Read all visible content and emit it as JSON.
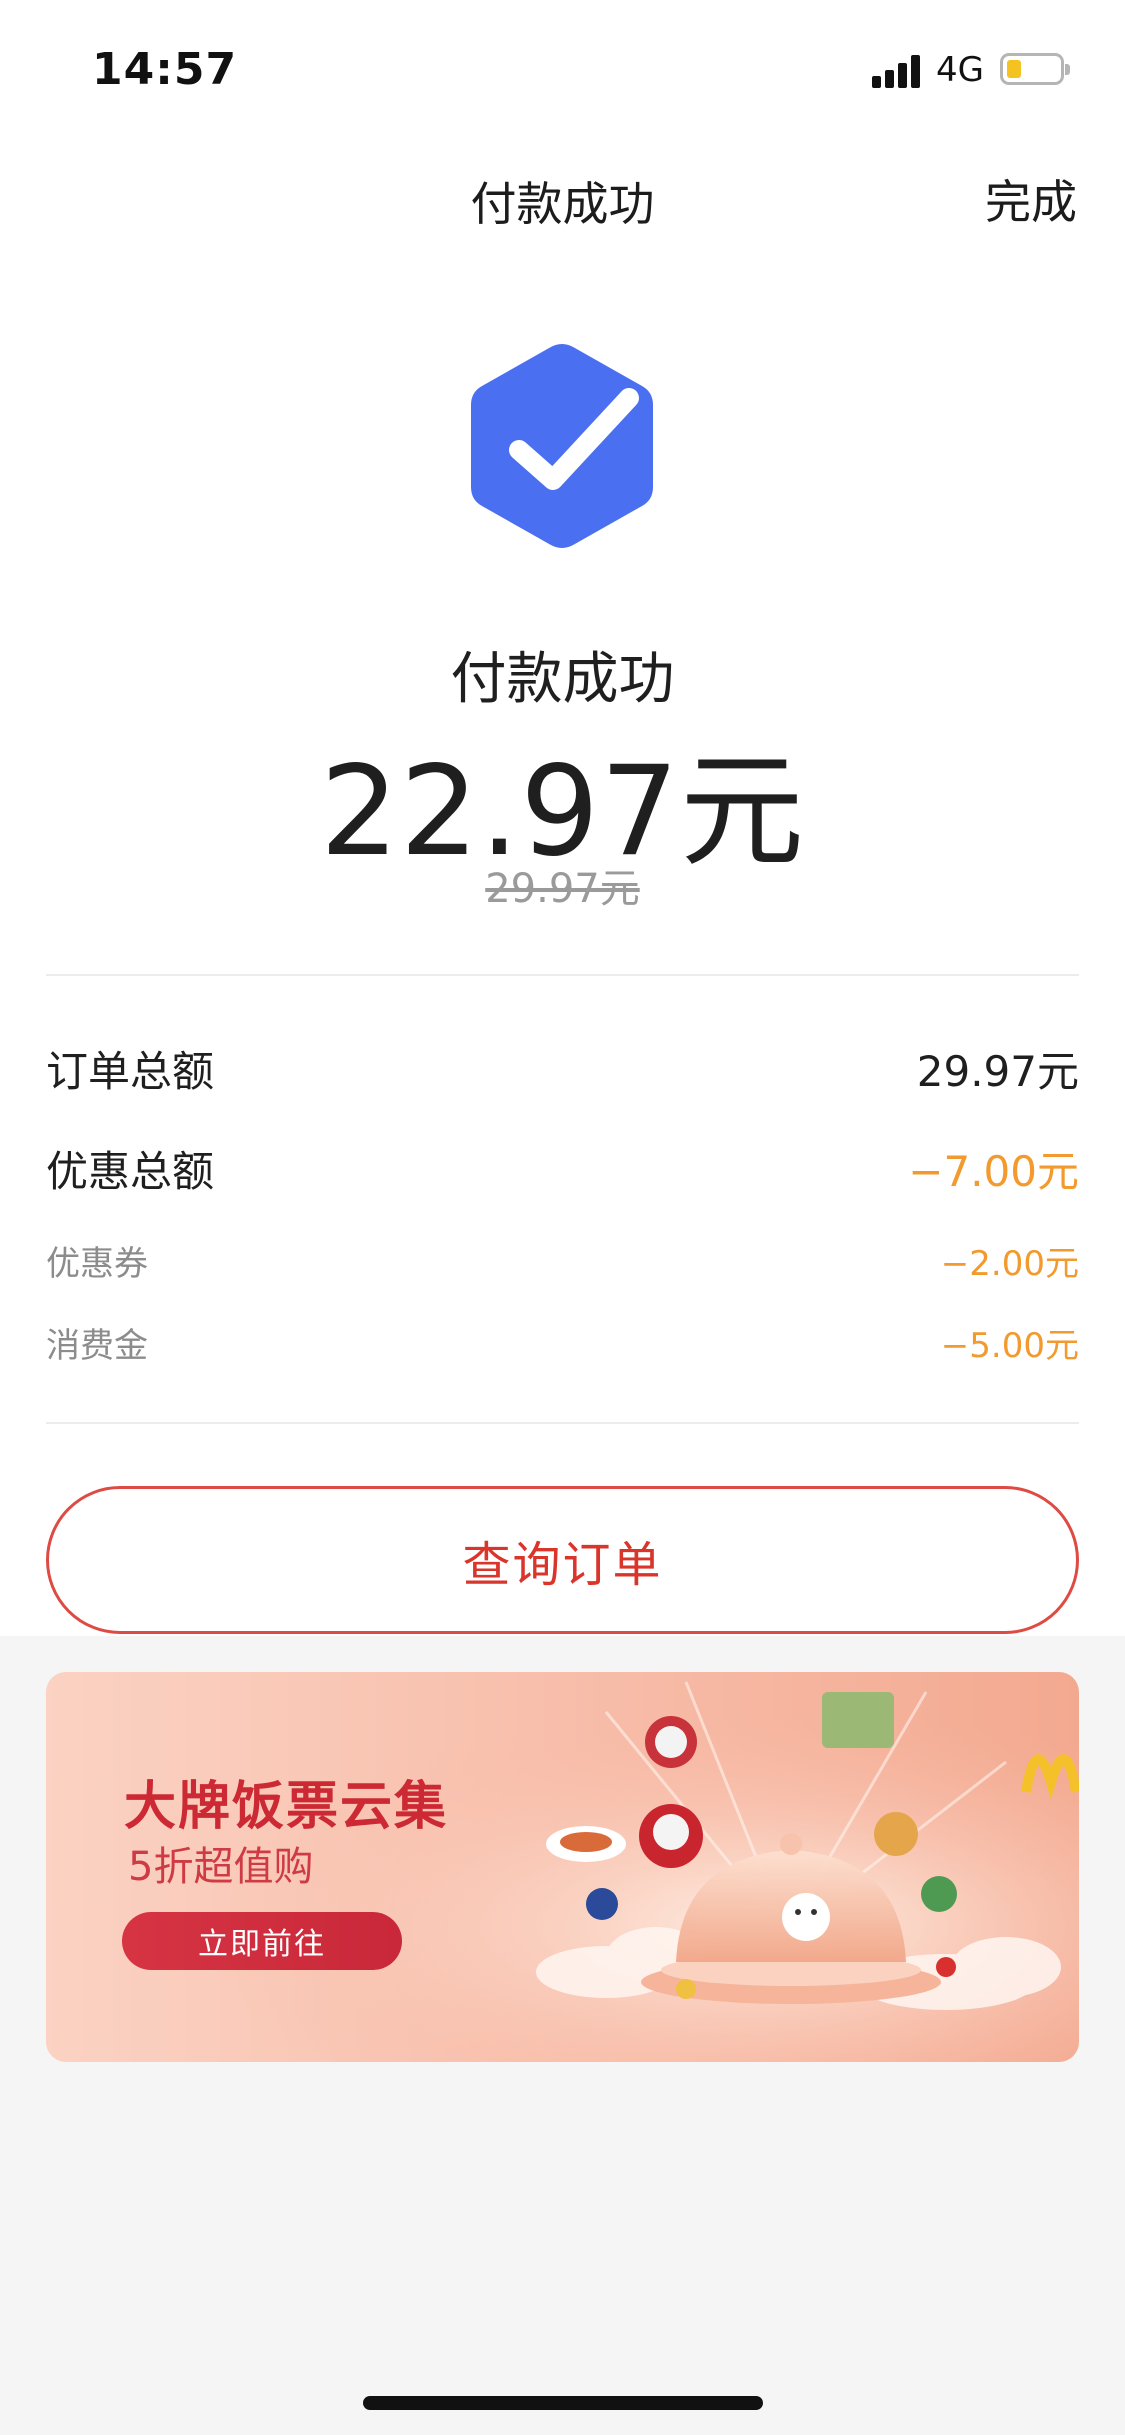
{
  "status_bar": {
    "time": "14:57",
    "network": "4G",
    "battery_level_fraction": 0.25,
    "battery_color": "#f4c321"
  },
  "nav": {
    "title": "付款成功",
    "done_label": "完成"
  },
  "result": {
    "icon": "check-hexagon-icon",
    "icon_color": "#4a6ff0",
    "title": "付款成功",
    "paid_amount": "22.97元",
    "original_amount": "29.97元"
  },
  "summary": {
    "order_total_label": "订单总额",
    "order_total_value": "29.97元",
    "discount_total_label": "优惠总额",
    "discount_total_value": "−7.00元",
    "items": [
      {
        "label": "优惠券",
        "value": "−2.00元"
      },
      {
        "label": "消费金",
        "value": "−5.00元"
      }
    ],
    "discount_color": "#f29a2e"
  },
  "actions": {
    "query_order_label": "查询订单",
    "accent_color": "#d9352b"
  },
  "banner": {
    "title": "大牌饭票云集",
    "subtitle": "5折超值购",
    "cta_label": "立即前往",
    "image": "brand-food-promo-illustration"
  }
}
